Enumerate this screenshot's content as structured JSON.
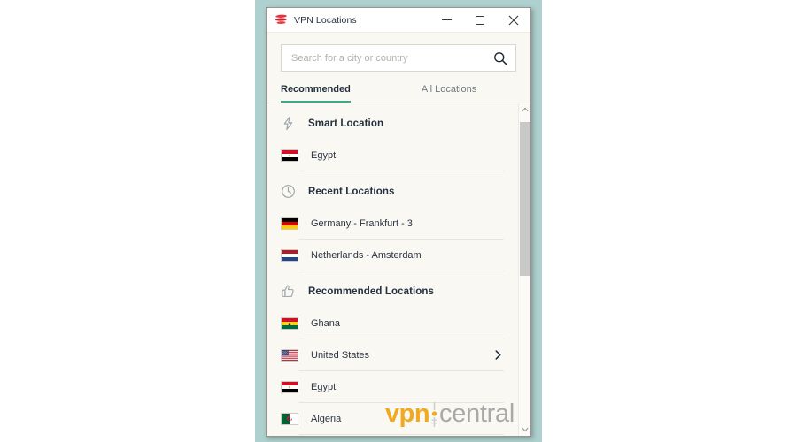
{
  "window": {
    "title": "VPN Locations",
    "app_icon": "expressvpn-logo-icon",
    "controls": {
      "minimize_label": "Minimize",
      "maximize_label": "Maximize",
      "close_label": "Close"
    }
  },
  "search": {
    "placeholder": "Search for a city or country",
    "value": "",
    "icon": "search-icon"
  },
  "tabs": [
    {
      "label": "Recommended",
      "active": true
    },
    {
      "label": "All Locations",
      "active": false
    }
  ],
  "sections": [
    {
      "title": "Smart Location",
      "icon": "lightning-bolt-icon",
      "items": [
        {
          "name": "Egypt",
          "flag": "eg",
          "expandable": false
        }
      ]
    },
    {
      "title": "Recent Locations",
      "icon": "clock-icon",
      "items": [
        {
          "name": "Germany - Frankfurt - 3",
          "flag": "de",
          "expandable": false
        },
        {
          "name": "Netherlands - Amsterdam",
          "flag": "nl",
          "expandable": false
        }
      ]
    },
    {
      "title": "Recommended Locations",
      "icon": "thumbs-up-icon",
      "items": [
        {
          "name": "Ghana",
          "flag": "gh",
          "expandable": false
        },
        {
          "name": "United States",
          "flag": "us",
          "expandable": true
        },
        {
          "name": "Egypt",
          "flag": "eg",
          "expandable": false
        },
        {
          "name": "Algeria",
          "flag": "dz",
          "expandable": false
        }
      ]
    }
  ],
  "scrollbar": {
    "up_arrow": "chevron-up-icon",
    "down_arrow": "chevron-down-icon",
    "thumb_top_pct": 2,
    "thumb_height_pct": 50
  },
  "watermark": {
    "primary": "vpn",
    "secondary": "central",
    "primary_color": "#f2a922",
    "secondary_color": "#a9a9a9"
  },
  "colors": {
    "backdrop": "#aed0ce",
    "window_bg": "#faf8f3",
    "accent_tab": "#3aa88c",
    "text": "#2b3442",
    "logo_red": "#e8323c"
  }
}
